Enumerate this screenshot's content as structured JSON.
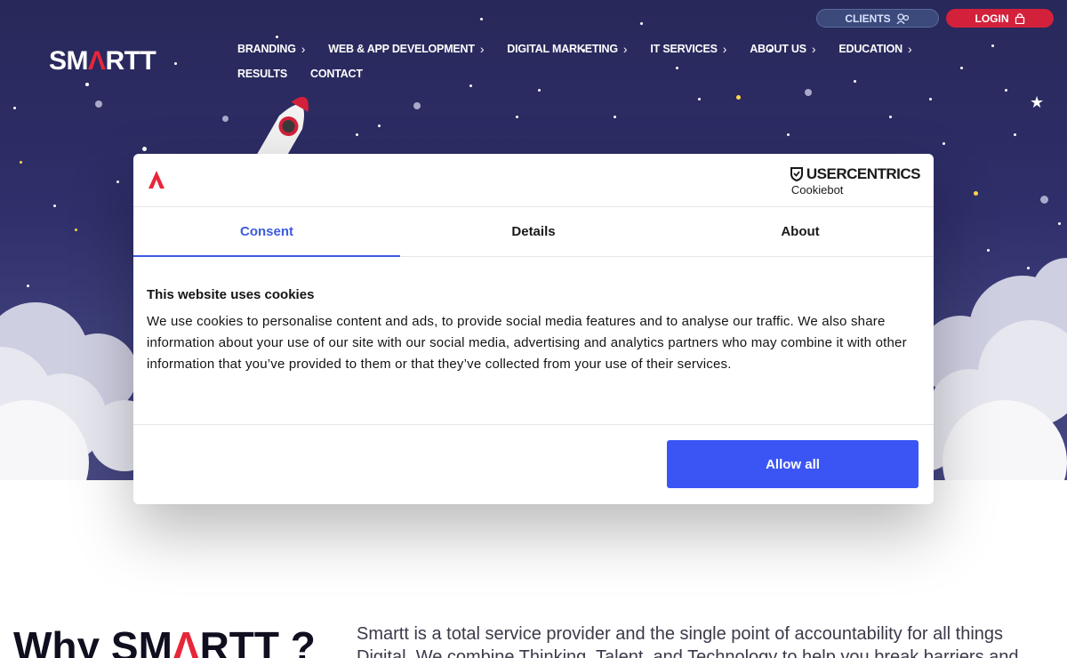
{
  "brand": {
    "logo_pre": "SM",
    "logo_accent": "Λ",
    "logo_post": "RTT",
    "accent_color": "#e8263a"
  },
  "top_buttons": {
    "clients": "CLIENTS",
    "login": "LOGIN"
  },
  "nav": {
    "items": [
      {
        "label": "BRANDING",
        "has_sub": true
      },
      {
        "label": "WEB & APP DEVELOPMENT",
        "has_sub": true
      },
      {
        "label": "DIGITAL MARKETING",
        "has_sub": true
      },
      {
        "label": "IT SERVICES",
        "has_sub": true
      },
      {
        "label": "ABOUT US",
        "has_sub": true
      },
      {
        "label": "EDUCATION",
        "has_sub": true
      }
    ],
    "items_row2": [
      {
        "label": "RESULTS"
      },
      {
        "label": "CONTACT"
      }
    ]
  },
  "dialog": {
    "provider_name": "USERCENTRICS",
    "provider_product": "Cookiebot",
    "tabs": [
      "Consent",
      "Details",
      "About"
    ],
    "active_tab": "Consent",
    "title": "This website uses cookies",
    "body": "We use cookies to personalise content and ads, to provide social media features and to analyse our traffic. We also share information about your use of our site with our social media, advertising and analytics partners who may combine it with other information that you’ve provided to them or that they’ve collected from your use of their services.",
    "allow_button": "Allow all",
    "button_color": "#3b55f5"
  },
  "why": {
    "pre": "Why ",
    "logo_pre": "SM",
    "logo_accent": "Λ",
    "logo_post": "RTT",
    "post": " ?"
  },
  "intro": "Smartt is a total service provider and the single point of accountability for all things Digital. We combine Thinking, Talent, and Technology to help you break barriers and"
}
